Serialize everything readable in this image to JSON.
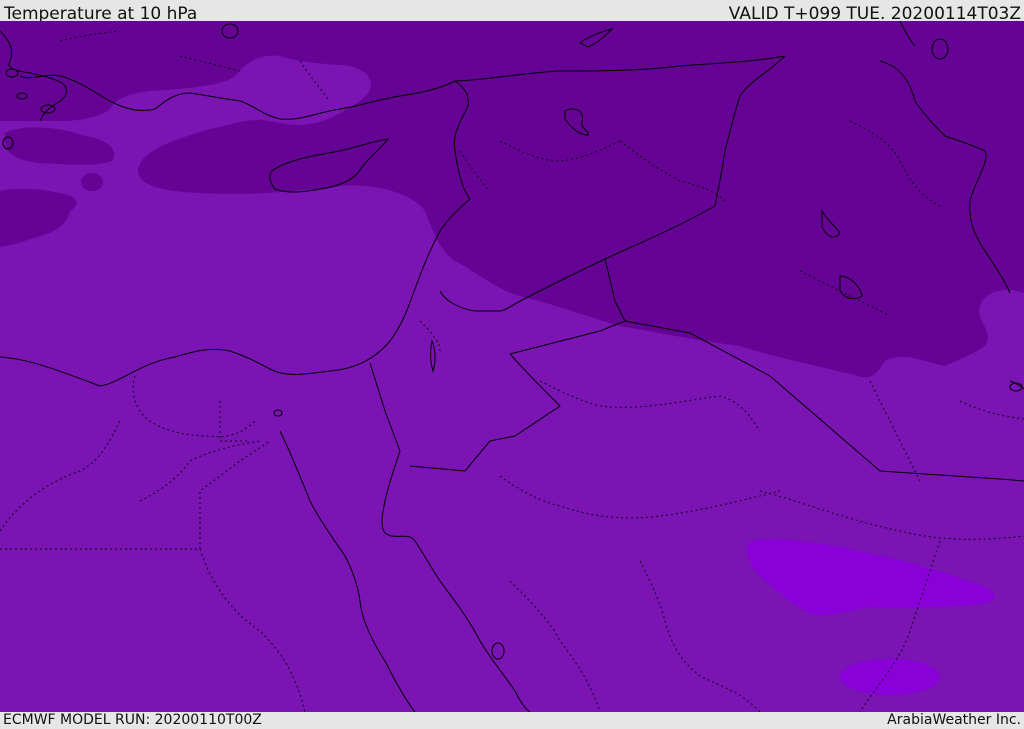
{
  "header": {
    "title": "Temperature at 10 hPa",
    "valid_time": "VALID T+099 TUE. 20200114T03Z"
  },
  "footer": {
    "model_run": "ECMWF MODEL RUN: 20200110T00Z",
    "credit": "ArabiaWeather Inc."
  },
  "colors": {
    "base_field": "#7a14b3",
    "cold_field": "#650394",
    "warm_patch": "#8a00d9",
    "coastline": "#000000",
    "border": "#000000",
    "panel_background": "#e6e6e6"
  }
}
